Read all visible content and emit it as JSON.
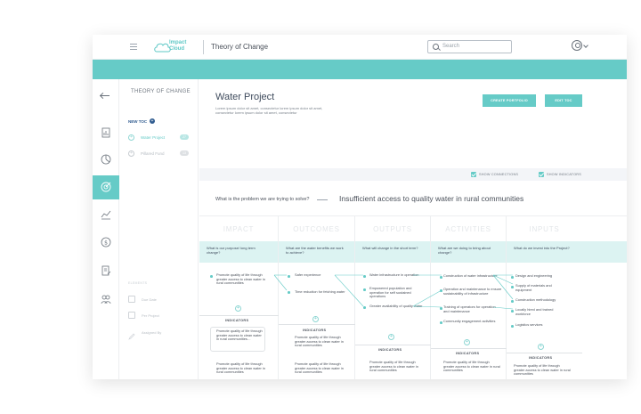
{
  "header": {
    "logo_line1": "Impact",
    "logo_line2": "Cloud",
    "app_title": "Theory of Change",
    "search_placeholder": "Search",
    "accent_color": "#66cbc7"
  },
  "leftnav": {
    "icons": [
      "back-arrow-icon",
      "document-chart-icon",
      "pie-chart-icon",
      "target-icon",
      "line-chart-icon",
      "dollar-cycle-icon",
      "edit-document-icon",
      "users-icon"
    ],
    "active": "target-icon"
  },
  "sidepanel": {
    "title": "THEORY OF CHANGE",
    "new_toc": "NEW TOC",
    "items": [
      {
        "label": "Water Project",
        "badge": "27"
      },
      {
        "label": "Pillared Fund",
        "badge": "13"
      }
    ],
    "section": "ELEMENTS",
    "meta": [
      {
        "label": "Due Date"
      },
      {
        "label": "Per Project"
      },
      {
        "label": "Assigned By"
      }
    ]
  },
  "main": {
    "title": "Water Project",
    "description": "Lorem ipsum dolor sit amet, consectetur lorem ipsum dolor sit amet, consectetur lorem ipsum dolor sit amet, consectetur",
    "create_portfolio": "CREATE PORTFOLIO",
    "edit_toc": "EDIT TOC",
    "show_connections": "SHOW CONNECTIONS",
    "show_indicators": "SHOW INDICATORS",
    "problem_question": "What is the problem we are trying to solve?",
    "problem_answer": "Insufficient access to quality water in rural communities"
  },
  "columns": [
    {
      "name": "IMPACT",
      "question": "What is our purpose/ long term change?",
      "items": [
        "Promote quality of life through greater access to clean water in rural communities"
      ],
      "indicators_label": "INDICATORS",
      "indicators": [
        "Promote quality of life through greater access to clean water in rural communities…",
        "Promote quality of life through greater access to clean water in rural communities"
      ]
    },
    {
      "name": "OUTCOMES",
      "question": "What are the water benefits we work to achieve?",
      "items": [
        "Safer experience",
        "Time reduction for fetching water"
      ],
      "indicators_label": "INDICATORS",
      "indicators": [
        "Promote quality of life through greater access to clean water in rural communities",
        "Promote quality of life through greater access to clean water in rural communities"
      ]
    },
    {
      "name": "OUTPUTS",
      "question": "What will change in the short term?",
      "items": [
        "Water infrastructure in operation",
        "Empowered population and operation for self sustained operations",
        "Greater availability of quality water"
      ],
      "indicators_label": "INDICATORS",
      "indicators": [
        "Promote quality of life through greater access to clean water in rural communities"
      ]
    },
    {
      "name": "ACTIVITIES",
      "question": "What are we doing to bring about change?",
      "items": [
        "Construction of water infrastructure",
        "Operation and maintenance to ensure sustainability of infrastructure",
        "Training of operators for operation and maintenance",
        "Community engagement activities"
      ],
      "indicators_label": "INDICATORS",
      "indicators": [
        "Promote quality of life through greater access to clean water in rural communities"
      ]
    },
    {
      "name": "INPUTS",
      "question": "What do we invest into the Project?",
      "items": [
        "Design and engineering",
        "Supply of materials and equipment",
        "Construction methodology",
        "Locally hired and trained workforce",
        "Logistics services"
      ],
      "indicators_label": "INDICATORS",
      "indicators": [
        "Promote quality of life through greater access to clean water in rural communities"
      ]
    }
  ]
}
